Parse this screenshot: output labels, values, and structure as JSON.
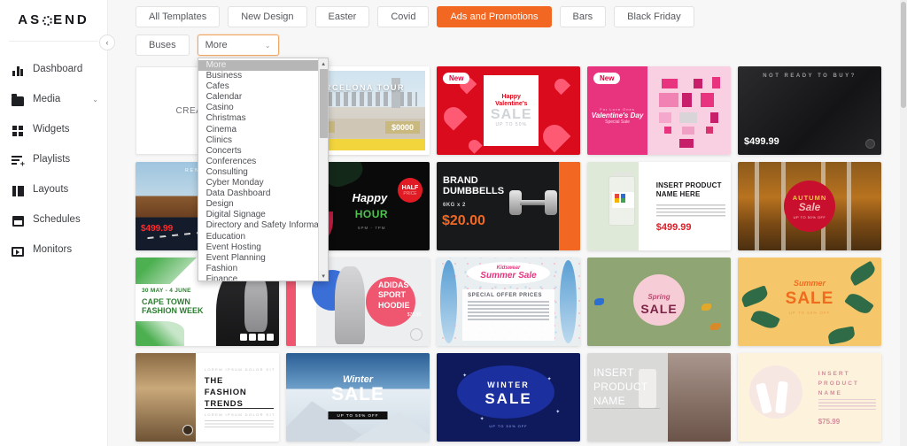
{
  "sidebar": {
    "brand": {
      "pre": "AS",
      "post": "END",
      "logo_icon": "ascend-logo"
    },
    "collapse_label": "‹",
    "items": [
      {
        "label": "Dashboard",
        "icon": "bar-chart-icon",
        "expandable": false
      },
      {
        "label": "Media",
        "icon": "folder-icon",
        "expandable": true,
        "chevron": "⌄"
      },
      {
        "label": "Widgets",
        "icon": "grid-icon",
        "expandable": false
      },
      {
        "label": "Playlists",
        "icon": "playlist-add-icon",
        "expandable": false
      },
      {
        "label": "Layouts",
        "icon": "layout-icon",
        "expandable": false
      },
      {
        "label": "Schedules",
        "icon": "calendar-icon",
        "expandable": false
      },
      {
        "label": "Monitors",
        "icon": "monitor-play-icon",
        "expandable": false
      }
    ]
  },
  "filters": {
    "row1": [
      "All Templates",
      "New Design",
      "Easter",
      "Covid",
      "Ads and Promotions",
      "Bars",
      "Black Friday"
    ],
    "active": "Ads and Promotions",
    "row2_chip": "Buses",
    "select": {
      "value": "More",
      "chevron": "⌄"
    }
  },
  "dropdown": {
    "selected": "More",
    "scroll_up": "▴",
    "scroll_down": "▾",
    "options": [
      "More",
      "Business",
      "Cafes",
      "Calendar",
      "Casino",
      "Christmas",
      "Cinema",
      "Clinics",
      "Concerts",
      "Conferences",
      "Consulting",
      "Cyber Monday",
      "Data Dashboard",
      "Design",
      "Digital Signage",
      "Directory and Safety Information",
      "Education",
      "Event Hosting",
      "Event Planning",
      "Fashion",
      "Finance"
    ]
  },
  "grid": {
    "create_card": {
      "label": "CREATE NEW"
    },
    "cards": [
      {
        "id": "barcelona-tour",
        "title": "BARCELONA TOUR",
        "price": "$0000"
      },
      {
        "id": "happy-valentines-sale",
        "badge": "New",
        "line1": "Happy",
        "line2": "Valentine's",
        "line3": "SALE",
        "line4": "UP TO 50%"
      },
      {
        "id": "valentines-day-special-sale",
        "badge": "New",
        "line1": "For Love Ones",
        "line2": "Valentine's Day",
        "line3": "Special Sale"
      },
      {
        "id": "not-ready-to-buy",
        "title": "NOT READY TO BUY?",
        "price": "$499.99"
      },
      {
        "id": "rent-a-car",
        "title": "RENT A CAR",
        "price": "$499.99"
      },
      {
        "id": "happy-hour",
        "line1": "Happy",
        "line2": "HOUR",
        "line3": "5PM - 7PM",
        "badge1": "HALF",
        "badge2": "PRICE"
      },
      {
        "id": "brand-dumbbells",
        "line1": "BRAND",
        "line2": "DUMBBELLS",
        "line3": "6KG x 2",
        "price": "$20.00"
      },
      {
        "id": "insert-product-name-here",
        "line1": "INSERT PRODUCT",
        "line2": "NAME HERE",
        "price": "$499.99"
      },
      {
        "id": "autumn-sale",
        "line1": "AUTUMN",
        "line2": "Sale",
        "line3": "UP TO 50% OFF"
      },
      {
        "id": "cape-town-fashion-week",
        "line1": "30 MAY - 4 JUNE",
        "line2": "CAPE TOWN",
        "line3": "FASHION WEEK"
      },
      {
        "id": "adidas-sport-hoodie",
        "line1": "ADIDAS",
        "line2": "SPORT",
        "line3": "HOODIE",
        "price": "$79.99"
      },
      {
        "id": "kidswear-summer-sale",
        "line1": "Kidswear",
        "line2": "Summer Sale",
        "line3": "SPECIAL OFFER PRICES"
      },
      {
        "id": "spring-sale",
        "line1": "Spring",
        "line2": "SALE"
      },
      {
        "id": "summer-sale",
        "line1": "Summer",
        "line2": "SALE",
        "line3": "UP TO 50% OFF"
      },
      {
        "id": "the-fashion-trends",
        "line0": "LOREM IPSUM DOLOR SIT",
        "line1": "THE",
        "line2": "FASHION",
        "line3": "TRENDS",
        "line4": "LOREM IPSUM DOLOR SIT"
      },
      {
        "id": "winter-sale-photo",
        "line1": "Winter",
        "line2": "SALE",
        "line3": "UP TO 50% OFF"
      },
      {
        "id": "winter-sale-blue",
        "line1": "WINTER",
        "line2": "SALE",
        "line3": "UP TO 50% OFF"
      },
      {
        "id": "insert-product-name-grey",
        "line1": "INSERT",
        "line2": "PRODUCT",
        "line3": "NAME"
      },
      {
        "id": "insert-product-name-cream",
        "line1": "INSERT",
        "line2": "PRODUCT",
        "line3": "NAME",
        "price": "$75.99"
      }
    ]
  },
  "colors": {
    "accent": "#f26722",
    "sidebar_bg": "#ffffff",
    "canvas_bg": "#f7f7f7",
    "dropdown_selected": "#b6b6b6"
  }
}
